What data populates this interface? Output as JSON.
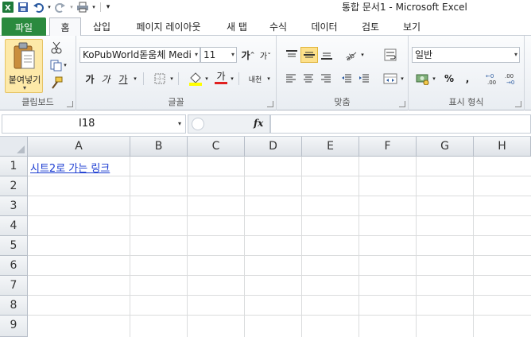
{
  "window": {
    "title": "통합 문서1  -  Microsoft Excel"
  },
  "tabs": {
    "file": "파일",
    "items": [
      "홈",
      "삽입",
      "페이지 레이아웃",
      "새 탭",
      "수식",
      "데이터",
      "검토",
      "보기"
    ],
    "active": "홈"
  },
  "ribbon": {
    "clipboard": {
      "paste_label": "붙여넣기",
      "group_label": "클립보드"
    },
    "font": {
      "font_name": "KoPubWorld돋움체 Medi",
      "font_size": "11",
      "grow": "가",
      "bold": "가",
      "italic": "가",
      "underline": "가",
      "font_color_glyph": "가",
      "phonetic": "내천",
      "group_label": "글꼴"
    },
    "alignment": {
      "group_label": "맞춤"
    },
    "number": {
      "format": "일반",
      "percent": "%",
      "comma": ",",
      "group_label": "표시 형식"
    }
  },
  "formula_bar": {
    "name_box": "I18",
    "fx": "fx",
    "formula": ""
  },
  "grid": {
    "columns": [
      "A",
      "B",
      "C",
      "D",
      "E",
      "F",
      "G",
      "H"
    ],
    "rows": [
      "1",
      "2",
      "3",
      "4",
      "5",
      "6",
      "7",
      "8",
      "9"
    ],
    "cells": {
      "A1": "시트2로 가는 링크 "
    }
  },
  "colors": {
    "file_tab": "#2a8a3e",
    "link": "#1a3bd1",
    "paste_highlight": "#fde9a8"
  }
}
